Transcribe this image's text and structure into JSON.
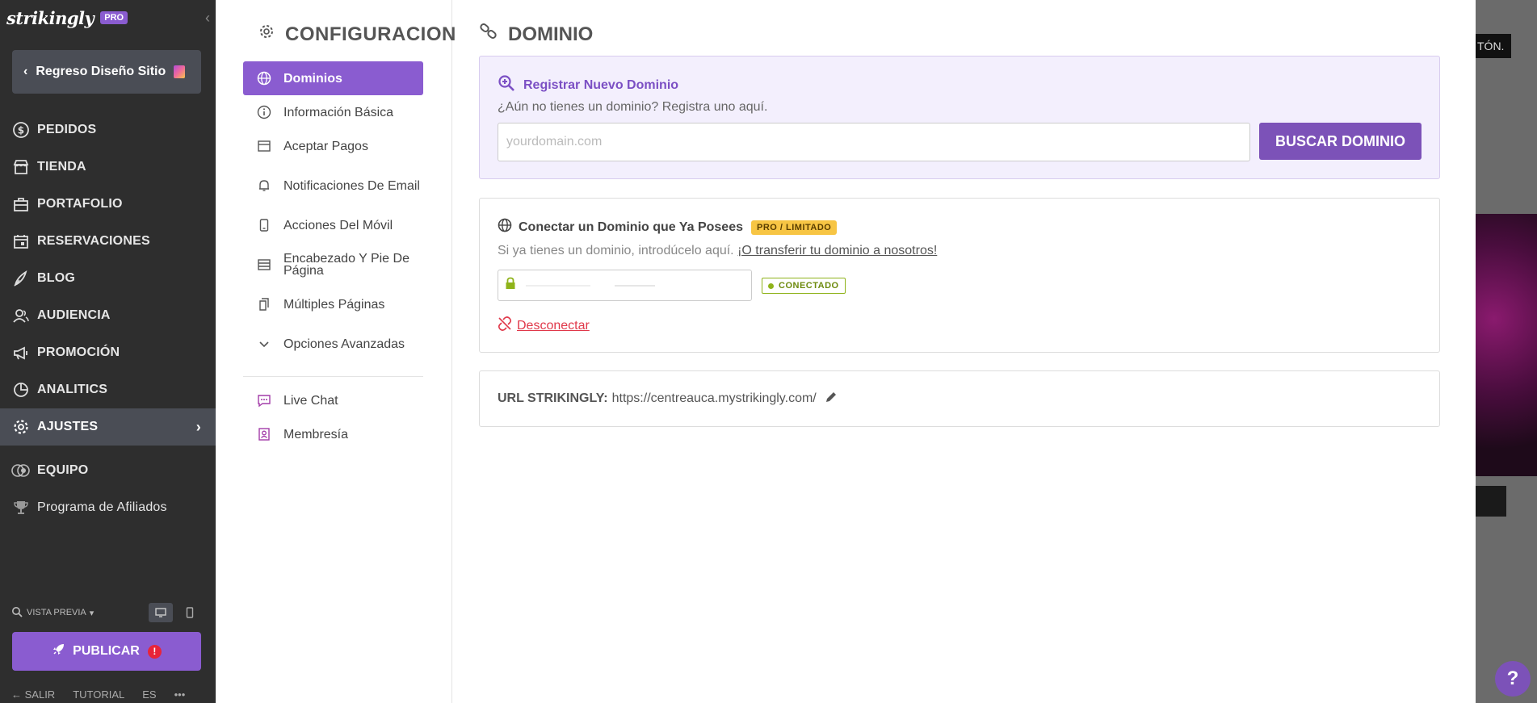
{
  "sidebar": {
    "brand": "strikingly",
    "pro_label": "PRO",
    "back_label": "Regreso Diseño Sitio",
    "nav": [
      {
        "label": "PEDIDOS",
        "icon": "dollar-icon"
      },
      {
        "label": "TIENDA",
        "icon": "store-icon"
      },
      {
        "label": "PORTAFOLIO",
        "icon": "briefcase-icon"
      },
      {
        "label": "RESERVACIONES",
        "icon": "calendar-icon"
      },
      {
        "label": "BLOG",
        "icon": "pen-icon"
      },
      {
        "label": "AUDIENCIA",
        "icon": "users-icon"
      },
      {
        "label": "PROMOCIÓN",
        "icon": "megaphone-icon"
      },
      {
        "label": "ANALITICS",
        "icon": "pie-chart-icon"
      },
      {
        "label": "AJUSTES",
        "icon": "gear-icon"
      }
    ],
    "team_label": "EQUIPO",
    "affiliate_label": "Programa de Afiliados",
    "preview_label": "VISTA PREVIA",
    "publish_label": "PUBLICAR",
    "footer": {
      "exit": "SALIR",
      "tutorial": "TUTORIAL",
      "lang": "ES",
      "more": "•••"
    }
  },
  "settings_nav": {
    "title": "CONFIGURACION",
    "items": [
      {
        "label": "Dominios",
        "icon": "globe-icon"
      },
      {
        "label": "Información Básica",
        "icon": "info-icon"
      },
      {
        "label": "Aceptar Pagos",
        "icon": "wallet-icon"
      },
      {
        "label": "Notificaciones De Email",
        "icon": "bell-icon"
      },
      {
        "label": "Acciones Del Móvil",
        "icon": "mobile-icon"
      },
      {
        "label": "Encabezado Y Pie De Página",
        "icon": "layout-icon"
      },
      {
        "label": "Múltiples Páginas",
        "icon": "pages-icon"
      },
      {
        "label": "Opciones Avanzadas",
        "icon": "chevron-down-icon"
      }
    ],
    "extras": [
      {
        "label": "Live Chat",
        "icon": "chat-icon"
      },
      {
        "label": "Membresía",
        "icon": "member-icon"
      }
    ]
  },
  "domain": {
    "title": "DOMINIO",
    "register": {
      "heading": "Registrar Nuevo Dominio",
      "subtitle": "¿Aún no tienes un dominio? Registra uno aquí.",
      "placeholder": "yourdomain.com",
      "value": "",
      "button": "BUSCAR DOMINIO"
    },
    "connect": {
      "heading": "Conectar un Dominio que Ya Posees",
      "badge": "PRO / LIMITADO",
      "subtitle": "Si ya tienes un dominio, introdúcelo aquí. ",
      "transfer_link": "¡O transferir tu dominio a nosotros!",
      "status": "CONECTADO",
      "disconnect": "Desconectar"
    },
    "url": {
      "label": "URL STRIKINGLY:",
      "value": "https://centreauca.mystrikingly.com/"
    }
  },
  "background": {
    "tooltip": "TÓN."
  },
  "colors": {
    "accent": "#8a5cd0",
    "sidebar": "#2e2e2e",
    "connected": "#8fb31a",
    "danger": "#e0384a"
  }
}
